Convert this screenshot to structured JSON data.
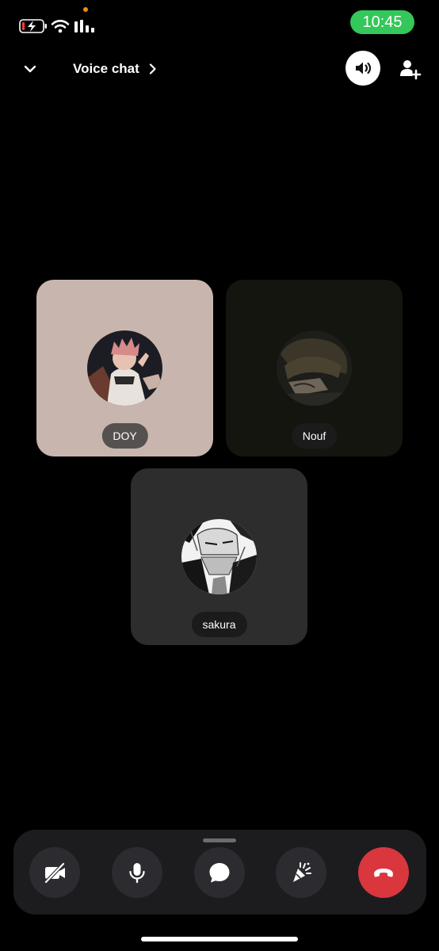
{
  "status_bar": {
    "time": "10:45",
    "icons": [
      "battery-charging-icon",
      "wifi-icon",
      "signal-icon"
    ],
    "colors": {
      "time_pill": "#34c759",
      "privacy_dot": "#f08a24"
    }
  },
  "header": {
    "title": "Voice chat",
    "icons": [
      "chevron-down-icon",
      "chevron-right-icon",
      "speaker-icon",
      "add-user-icon"
    ]
  },
  "participants": [
    {
      "name": "DOY",
      "tile_color": "#c8b6ae",
      "speaking": true
    },
    {
      "name": "Nouf",
      "tile_color": "#14150f",
      "speaking": false
    },
    {
      "name": "sakura",
      "tile_color": "#2d2d2d",
      "speaking": false
    }
  ],
  "controls": [
    {
      "id": "camera",
      "icon": "camera-off-icon",
      "state": "off"
    },
    {
      "id": "mic",
      "icon": "microphone-icon",
      "state": "on"
    },
    {
      "id": "chat",
      "icon": "chat-bubble-icon"
    },
    {
      "id": "activity",
      "icon": "party-popper-icon"
    },
    {
      "id": "end-call",
      "icon": "hang-up-icon",
      "color": "#d9363e"
    }
  ]
}
